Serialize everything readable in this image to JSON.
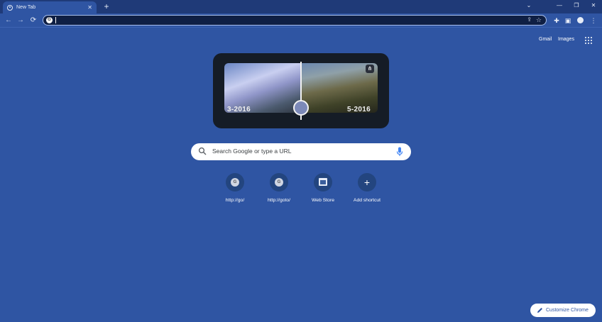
{
  "browser": {
    "tab": {
      "title": "New Tab",
      "close": "✕"
    },
    "new_tab": "+",
    "window_controls": {
      "minimize": "—",
      "restore": "❐",
      "close": "✕"
    },
    "tab_search": "⌄"
  },
  "toolbar": {
    "back": "←",
    "forward": "→",
    "reload": "⟳",
    "omnibox_value": ""
  },
  "top_links": {
    "gmail": "Gmail",
    "images": "Images"
  },
  "doodle": {
    "date_left": "3-2016",
    "date_right": "5-2016"
  },
  "search": {
    "placeholder": "Search Google or type a URL"
  },
  "shortcuts": [
    {
      "label": "http://go/",
      "icon": "G"
    },
    {
      "label": "http://goto/",
      "icon": "G"
    },
    {
      "label": "Web Store",
      "icon": "web-store-icon"
    },
    {
      "label": "Add shortcut",
      "icon": "+"
    }
  ],
  "customize": {
    "label": "Customize Chrome"
  },
  "colors": {
    "background": "#2f55a3",
    "tabstrip": "#1f3a78",
    "omnibox": "#0f1f44"
  }
}
